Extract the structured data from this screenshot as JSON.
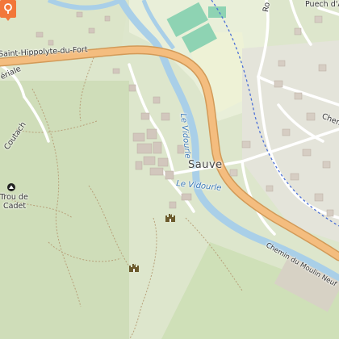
{
  "map": {
    "labels": {
      "road_hippolyte": "Saint-Hippolyte-du-Fort",
      "town": "Sauve",
      "river_vertical": "Le Vidourle",
      "river_horizontal": "Le Vidourle",
      "chemin_moulin": "Chemin du Moulin Neuf",
      "puech": "Puech d'Arn",
      "chemin_right": "Chemi",
      "peak_name_line1": "Trou de",
      "peak_name_line2": "Cadet",
      "left_road_top": "ve",
      "left_road_mid": "ériale",
      "left_road_low": "Coutach",
      "top_right_road": "Ro"
    },
    "icons": {
      "location_pin": "location-pin-icon",
      "castle_1": "castle-icon",
      "castle_2": "castle-icon",
      "peak": "peak-icon"
    },
    "colors": {
      "pin": "#f2773a",
      "major_road": "#f4bd7f",
      "river": "#a9cfe8",
      "forest": "#c9d9b5",
      "building": "#d2c7bd",
      "rail": "#4b6fd6"
    }
  }
}
